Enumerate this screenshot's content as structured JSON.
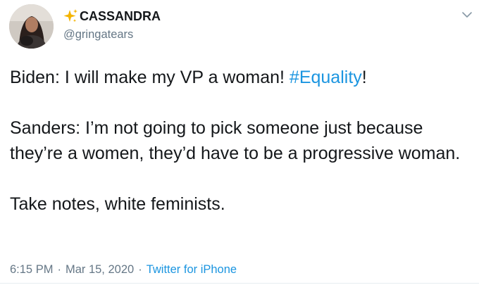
{
  "author": {
    "emoji": "✨",
    "display_name": "CASSANDRA",
    "handle": "@gringatears"
  },
  "tweet": {
    "line1_prefix": "Biden: I will make my VP a woman! ",
    "line1_hashtag": "#Equality",
    "line1_suffix": "!",
    "paragraph2": "Sanders: I’m not going to pick someone just because they’re a women, they’d have to be a progressive woman.",
    "paragraph3": "Take notes, white feminists."
  },
  "meta": {
    "time": "6:15 PM",
    "separator1": "·",
    "date": "Mar 15, 2020",
    "separator2": "·",
    "source": "Twitter for iPhone"
  },
  "colors": {
    "link": "#1b95e0",
    "secondary_text": "#657786",
    "primary_text": "#14171a",
    "sparkle": "#f4b400"
  },
  "icons": {
    "sparkle": "sparkles-icon",
    "menu": "chevron-down-icon"
  }
}
